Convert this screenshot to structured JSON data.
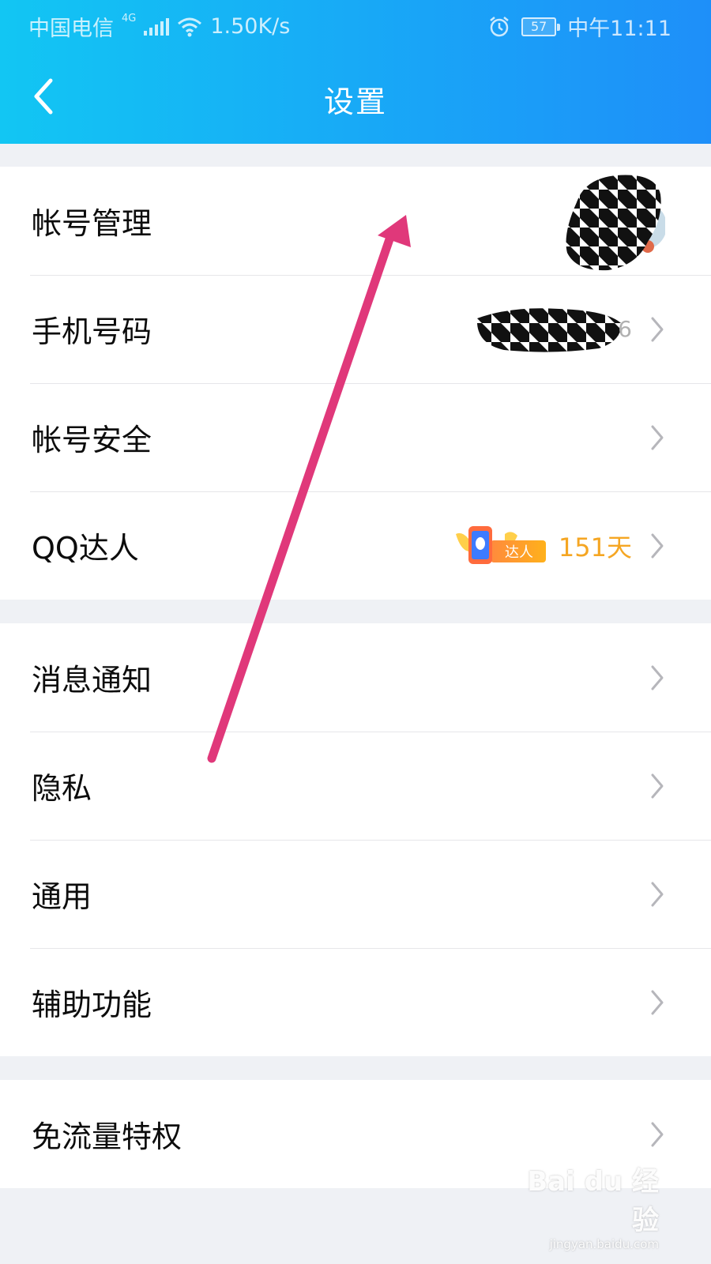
{
  "status_bar": {
    "carrier": "中国电信",
    "network": "4G",
    "speed": "1.50K/s",
    "battery": "57",
    "time": "中午11:11"
  },
  "header": {
    "title": "设置",
    "back_icon": "chevron-left-icon"
  },
  "groups": [
    {
      "items": [
        {
          "label": "帐号管理",
          "right": "avatar"
        },
        {
          "label": "手机号码",
          "right_text": "6"
        },
        {
          "label": "帐号安全"
        },
        {
          "label": "QQ达人",
          "badge_text": "达人",
          "right_text": "151天"
        }
      ]
    },
    {
      "items": [
        {
          "label": "消息通知"
        },
        {
          "label": "隐私"
        },
        {
          "label": "通用"
        },
        {
          "label": "辅助功能"
        }
      ]
    },
    {
      "items": [
        {
          "label": "免流量特权"
        }
      ]
    }
  ],
  "colors": {
    "header_start": "#12c6f3",
    "header_end": "#1e8ff9",
    "accent_orange": "#f5a623",
    "annotation_arrow": "#e0387a"
  },
  "watermark": {
    "main": "Bai du 经验",
    "sub": "jingyan.baidu.com"
  }
}
